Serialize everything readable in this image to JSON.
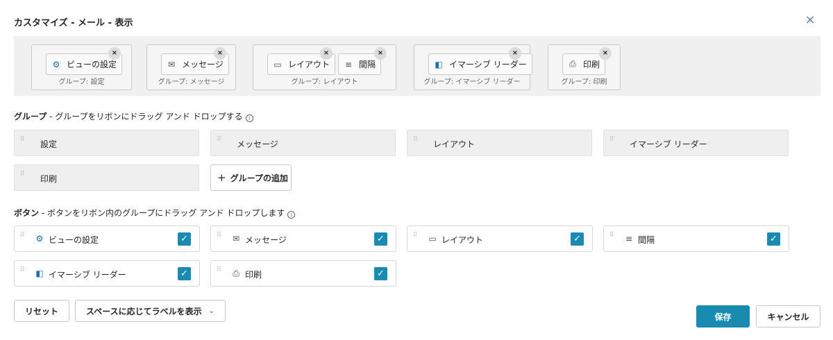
{
  "dialog": {
    "title": "カスタマイズ - メール - 表示",
    "close_icon": "×"
  },
  "ribbon": {
    "groups": [
      {
        "caption": "グループ: 設定",
        "buttons": [
          {
            "label": "ビューの設定",
            "icon": "gear-icon",
            "glyph": "⚙"
          }
        ]
      },
      {
        "caption": "グループ: メッセージ",
        "buttons": [
          {
            "label": "メッセージ",
            "icon": "mail-icon",
            "glyph": "✉"
          }
        ]
      },
      {
        "caption": "グループ: レイアウト",
        "buttons": [
          {
            "label": "レイアウト",
            "icon": "layout-icon",
            "glyph": "▭"
          },
          {
            "label": "間隔",
            "icon": "spacing-icon",
            "glyph": "≡"
          }
        ]
      },
      {
        "caption": "グループ: イマーシブ リーダー",
        "buttons": [
          {
            "label": "イマーシブ リーダー",
            "icon": "immersive-reader-icon",
            "glyph": "◧"
          }
        ]
      },
      {
        "caption": "グループ: 印刷",
        "buttons": [
          {
            "label": "印刷",
            "icon": "printer-icon",
            "glyph": "⎙"
          }
        ]
      }
    ],
    "remove_glyph": "×"
  },
  "groups_section": {
    "heading_bold": "グループ",
    "heading_rest": " - グループをリボンにドラッグ アンド ドロップする",
    "info_glyph": "i",
    "items": [
      "設定",
      "メッセージ",
      "レイアウト",
      "イマーシブ リーダー",
      "印刷"
    ],
    "add_group_label": "グループの追加",
    "add_glyph": "+"
  },
  "buttons_section": {
    "heading_bold": "ボタン",
    "heading_rest": " - ボタンをリボン内のグループにドラッグ アンド ドロップします",
    "info_glyph": "i",
    "items": [
      {
        "label": "ビューの設定",
        "icon": "gear-icon",
        "glyph": "⚙",
        "checked": true
      },
      {
        "label": "メッセージ",
        "icon": "mail-icon",
        "glyph": "✉",
        "checked": true
      },
      {
        "label": "レイアウト",
        "icon": "layout-icon",
        "glyph": "▭",
        "checked": true
      },
      {
        "label": "間隔",
        "icon": "spacing-icon",
        "glyph": "≡",
        "checked": true
      },
      {
        "label": "イマーシブ リーダー",
        "icon": "immersive-reader-icon",
        "glyph": "◧",
        "checked": true
      },
      {
        "label": "印刷",
        "icon": "printer-icon",
        "glyph": "⎙",
        "checked": true
      }
    ],
    "check_glyph": "✓"
  },
  "footer": {
    "reset_label": "リセット",
    "label_mode_label": "スペースに応じてラベルを表示",
    "chevron_glyph": "⌄",
    "save_label": "保存",
    "cancel_label": "キャンセル"
  },
  "colors": {
    "accent": "#1a8bb0",
    "icon_blue": "#1a6fb5"
  }
}
